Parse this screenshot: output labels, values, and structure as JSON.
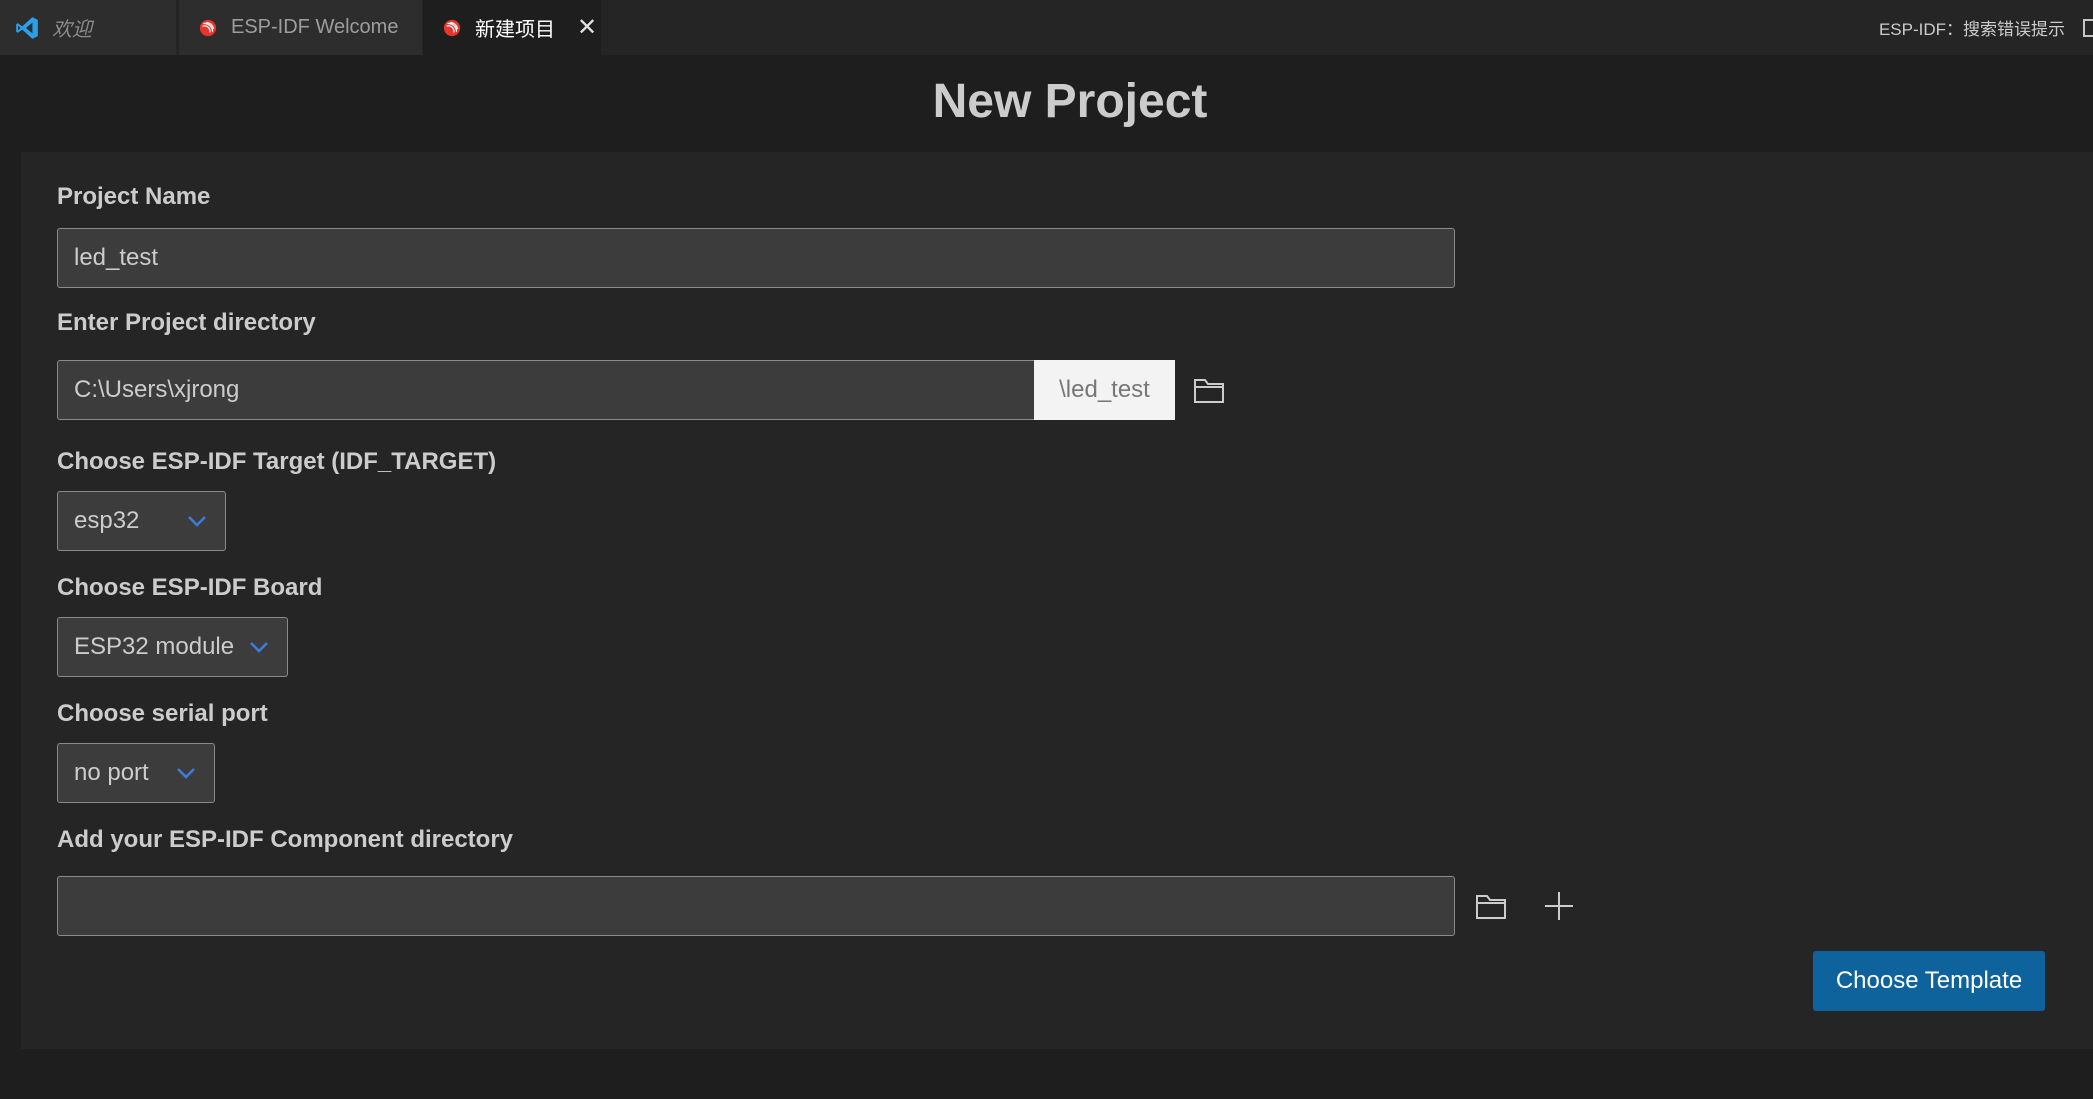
{
  "tabs": [
    {
      "label": "欢迎",
      "icon": "vscode-icon"
    },
    {
      "label": "ESP-IDF Welcome",
      "icon": "espressif-icon"
    },
    {
      "label": "新建项目",
      "icon": "espressif-icon",
      "active": true,
      "close": "✕"
    }
  ],
  "status_right": "ESP-IDF：搜索错误提示",
  "page_title": "New Project",
  "project_name": {
    "label": "Project Name",
    "value": "led_test"
  },
  "project_dir": {
    "label": "Enter Project directory",
    "value": "C:\\Users\\xjrong",
    "suffix": "\\led_test"
  },
  "target": {
    "label": "Choose ESP-IDF Target (IDF_TARGET)",
    "value": "esp32"
  },
  "board": {
    "label": "Choose ESP-IDF Board",
    "value": "ESP32 module"
  },
  "serial": {
    "label": "Choose serial port",
    "value": "no port"
  },
  "component_dir": {
    "label": "Add your ESP-IDF Component directory",
    "value": ""
  },
  "choose_template": "Choose Template",
  "colors": {
    "accent": "#0e639c",
    "chevron": "#3d7bd8",
    "espressif": "#e8362d",
    "vscode": "#2d9ee9"
  }
}
